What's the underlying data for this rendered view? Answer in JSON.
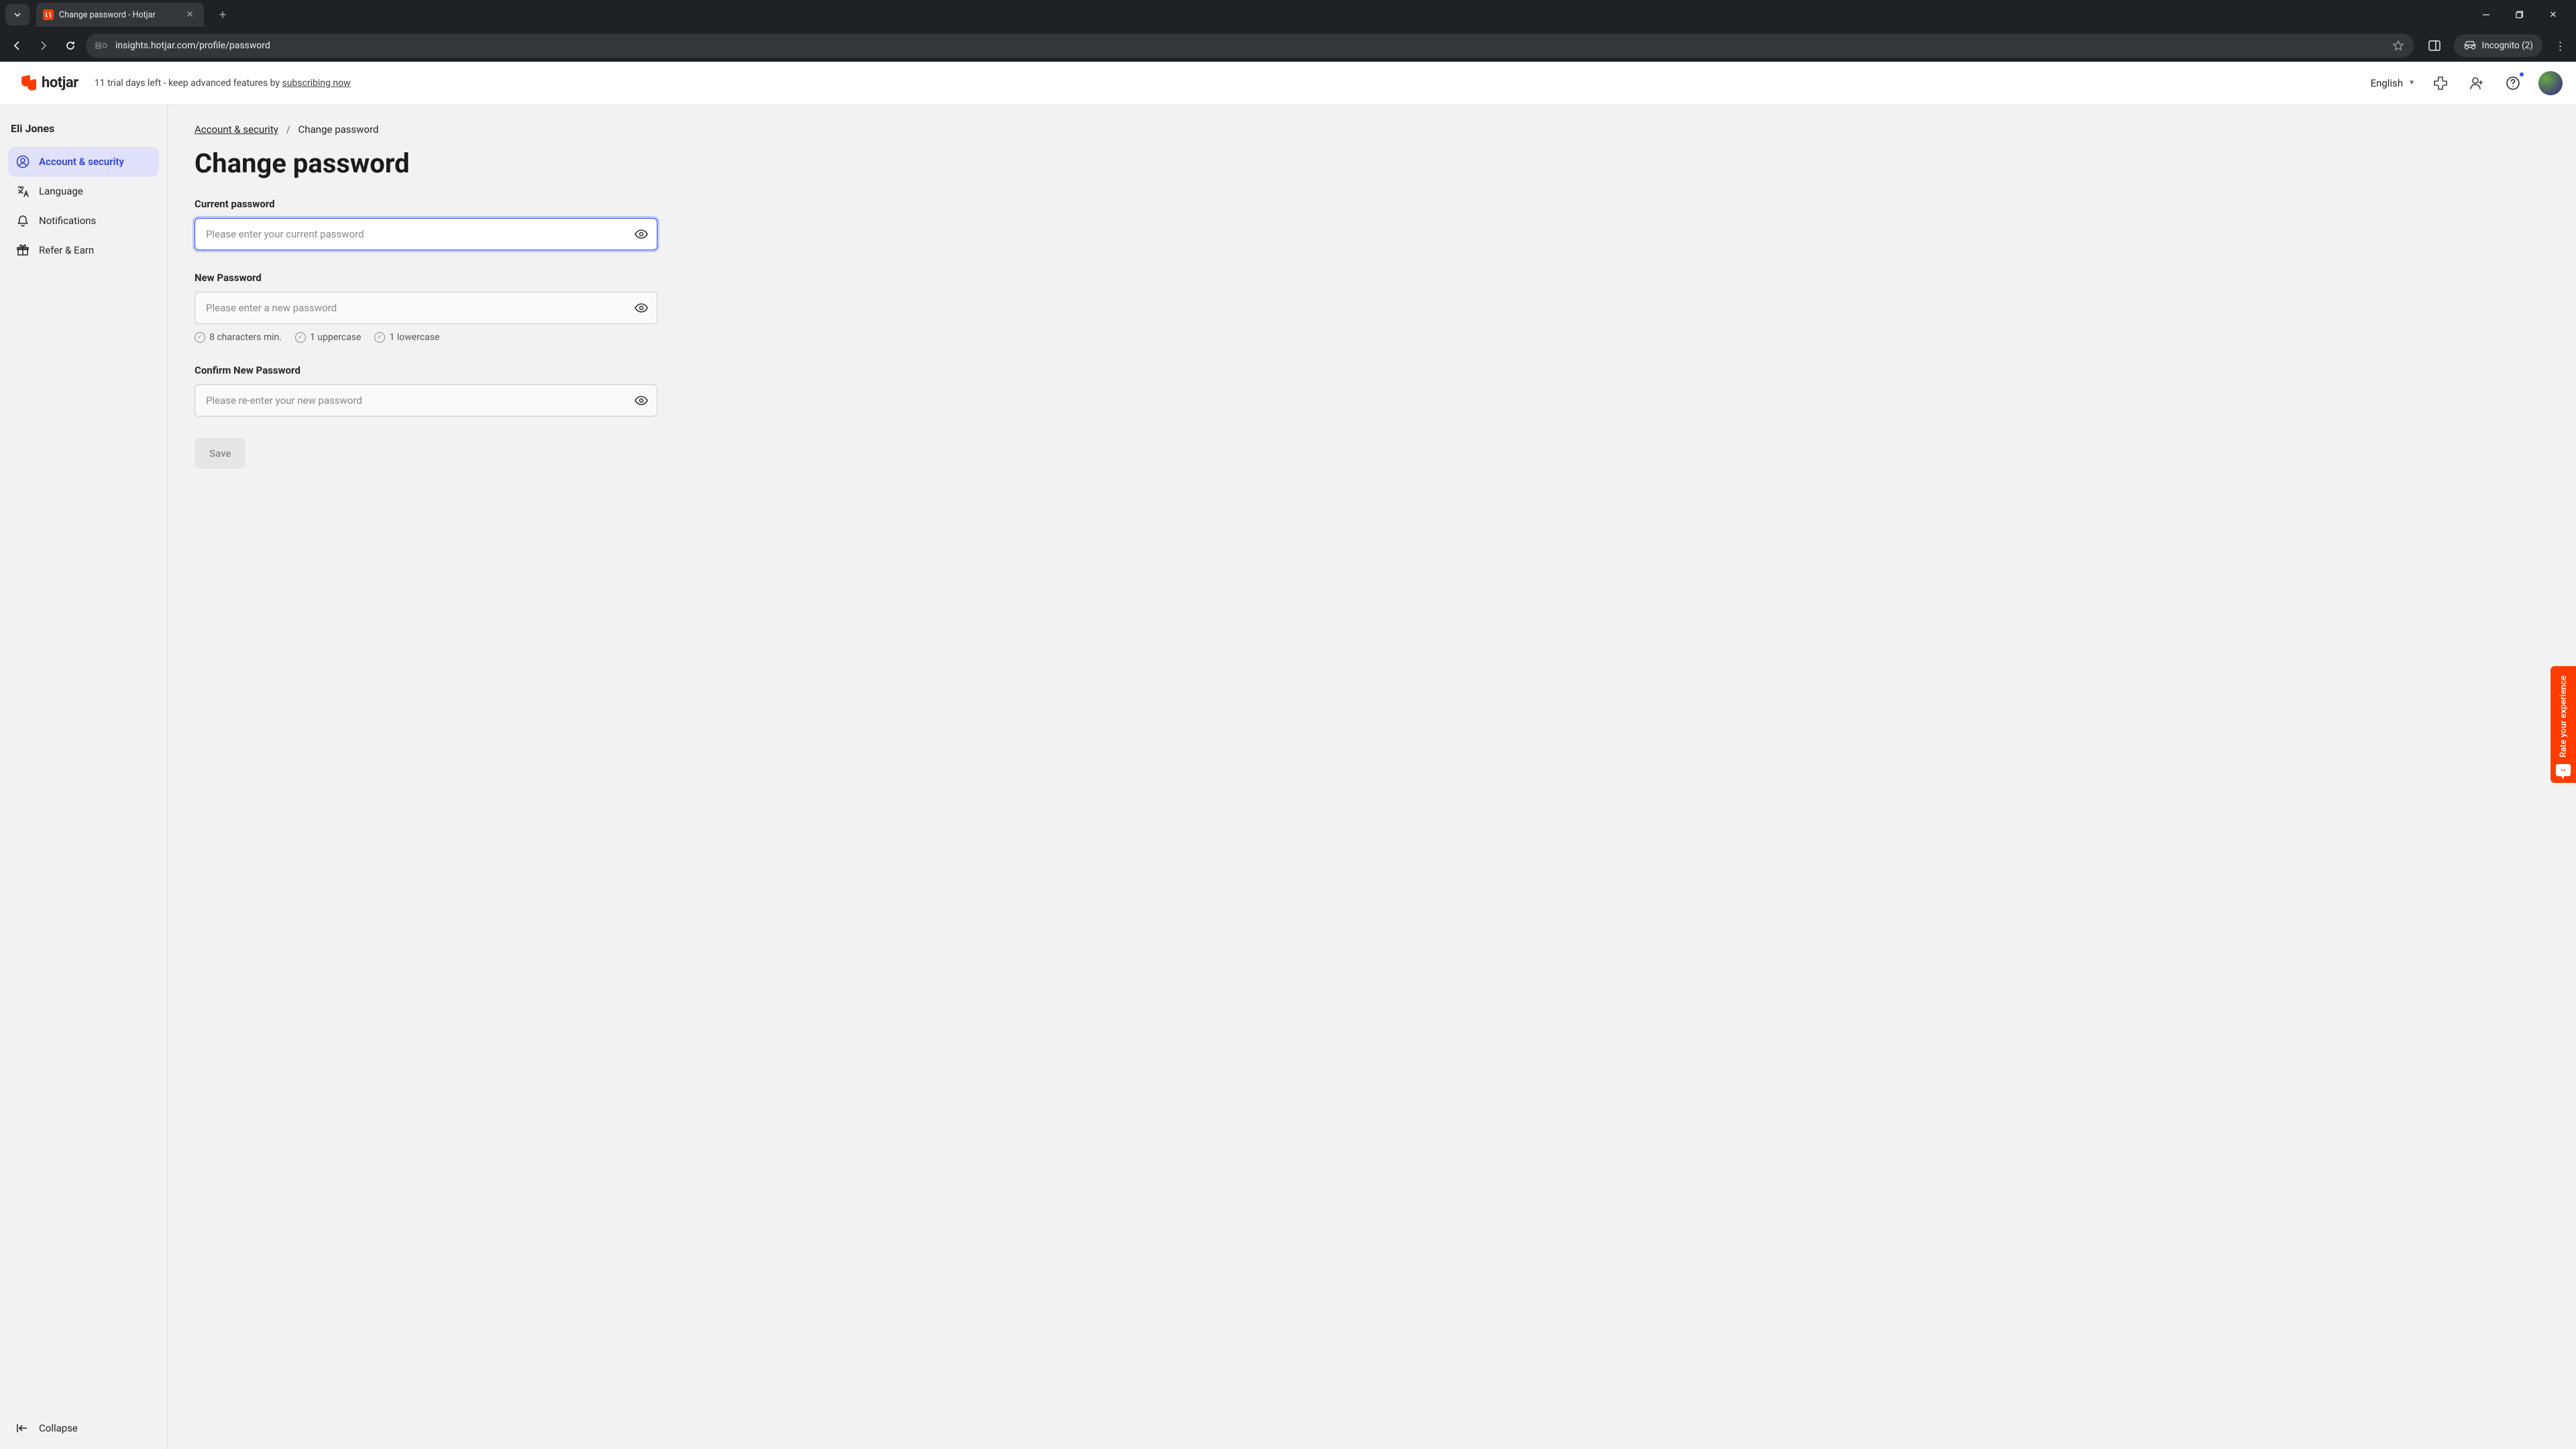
{
  "browser": {
    "tab_title": "Change password - Hotjar",
    "url_display": "insights.hotjar.com/profile/password",
    "incognito_label": "Incognito (2)"
  },
  "header": {
    "logo_text": "hotjar",
    "trial_prefix": "11 trial days left - keep advanced features by ",
    "trial_link": "subscribing now",
    "language": "English"
  },
  "sidebar": {
    "username": "Eli Jones",
    "items": [
      {
        "label": "Account & security"
      },
      {
        "label": "Language"
      },
      {
        "label": "Notifications"
      },
      {
        "label": "Refer & Earn"
      }
    ],
    "collapse": "Collapse"
  },
  "breadcrumb": {
    "root": "Account & security",
    "current": "Change password"
  },
  "page": {
    "title": "Change password",
    "current_label": "Current password",
    "current_placeholder": "Please enter your current password",
    "new_label": "New Password",
    "new_placeholder": "Please enter a new password",
    "confirm_label": "Confirm New Password",
    "confirm_placeholder": "Please re-enter your new password",
    "hints": {
      "min": "8 characters min.",
      "upper": "1 uppercase",
      "lower": "1 lowercase"
    },
    "save": "Save"
  },
  "feedback": {
    "label": "Rate your experience"
  }
}
